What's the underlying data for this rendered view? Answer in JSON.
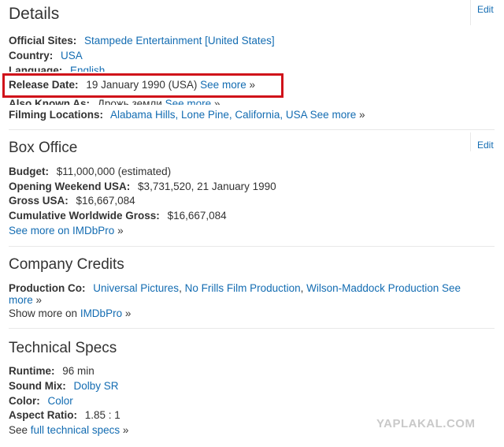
{
  "details": {
    "title": "Details",
    "edit": "Edit",
    "official_sites_label": "Official Sites:",
    "official_sites_value": "Stampede Entertainment [United States]",
    "country_label": "Country:",
    "country_value": "USA",
    "language_label": "Language:",
    "language_value": "English",
    "release_label": "Release Date:",
    "release_value": "19 January 1990 (USA)",
    "release_more": "See more",
    "aka_label": "Also Known As:",
    "aka_value": "Дрожь земли",
    "aka_more": "See more",
    "filming_label": "Filming Locations:",
    "filming_value": "Alabama Hills, Lone Pine, California, USA",
    "filming_more": "See more",
    "raquo": "»"
  },
  "box_office": {
    "title": "Box Office",
    "edit": "Edit",
    "budget_label": "Budget:",
    "budget_value": "$11,000,000 (estimated)",
    "opening_label": "Opening Weekend USA:",
    "opening_value": "$3,731,520, 21 January 1990",
    "gross_label": "Gross USA:",
    "gross_value": "$16,667,084",
    "cumulative_label": "Cumulative Worldwide Gross:",
    "cumulative_value": "$16,667,084",
    "see_more_pro": "See more on IMDbPro"
  },
  "company": {
    "title": "Company Credits",
    "production_label": "Production Co:",
    "production_1": "Universal Pictures",
    "production_2": "No Frills Film Production",
    "production_3": "Wilson-Maddock Production",
    "see": "See",
    "more": "more",
    "show_more_prefix": "Show more on",
    "imdbpro": "IMDbPro",
    "sep": ","
  },
  "tech": {
    "title": "Technical Specs",
    "runtime_label": "Runtime:",
    "runtime_value": "96 min",
    "sound_label": "Sound Mix:",
    "sound_value": "Dolby SR",
    "color_label": "Color:",
    "color_value": "Color",
    "aspect_label": "Aspect Ratio:",
    "aspect_value": "1.85 : 1",
    "see_prefix": "See",
    "full_specs": "full technical specs"
  },
  "watermark": "YAPLAKAL.COM",
  "colors": {
    "link": "#136cb2",
    "highlight": "#d0121a",
    "text": "#333333"
  }
}
